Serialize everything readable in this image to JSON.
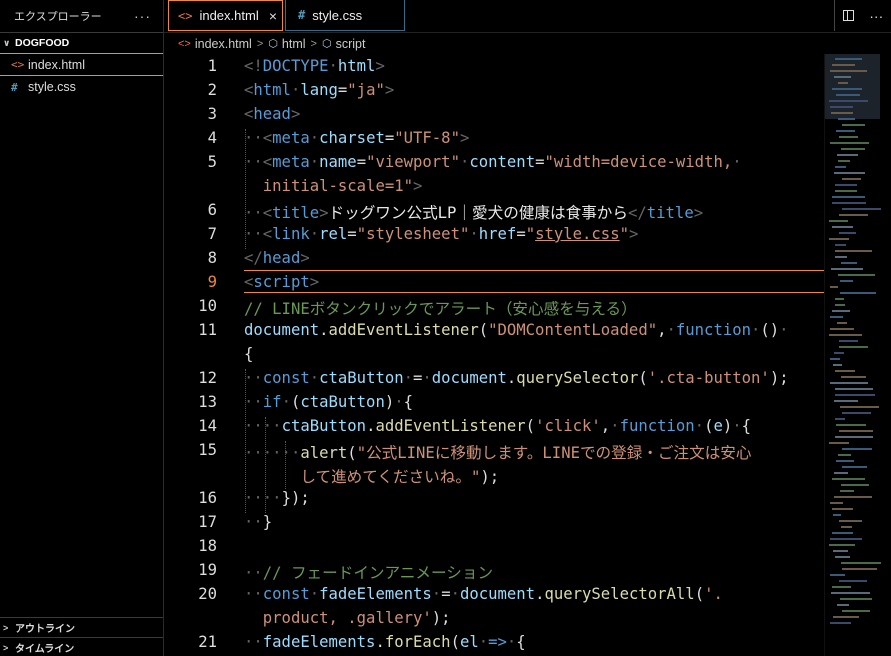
{
  "sidebar": {
    "title": "エクスプローラー",
    "more": "···",
    "folder": "DOGFOOD",
    "files": [
      {
        "name": "index.html",
        "icon": "<>"
      },
      {
        "name": "style.css",
        "icon": "#"
      }
    ],
    "outline": "アウトライン",
    "timeline": "タイムライン"
  },
  "tabs": [
    {
      "label": "index.html",
      "icon": "<>",
      "close": "×"
    },
    {
      "label": "style.css",
      "icon": "#"
    }
  ],
  "breadcrumb": [
    "index.html",
    "html",
    "script"
  ],
  "lines": [
    "1",
    "2",
    "3",
    "4",
    "5",
    "6",
    "7",
    "8",
    "9",
    "10",
    "11",
    "12",
    "13",
    "14",
    "15",
    "16",
    "17",
    "18",
    "19",
    "20",
    "21"
  ],
  "colors": {
    "accent": "#f0883e",
    "keyword": "#569cd6",
    "string": "#ce9178",
    "comment": "#6a9955",
    "function": "#dcdcaa"
  },
  "code": {
    "l1": {
      "open": "<!",
      "kw": "DOCTYPE",
      "rest": "html",
      "close": ">"
    },
    "l2": {
      "tag": "html",
      "attr": "lang",
      "val": "\"ja\""
    },
    "l3": {
      "tag": "head"
    },
    "l4": {
      "tag": "meta",
      "attr": "charset",
      "val": "\"UTF-8\""
    },
    "l5": {
      "tag": "meta",
      "attr1": "name",
      "val1": "\"viewport\"",
      "attr2": "content",
      "val2a": "\"width=device-width,",
      "val2b": "initial-scale=1\""
    },
    "l6": {
      "tag": "title",
      "text": "ドッグワン公式LP｜愛犬の健康は食事から"
    },
    "l7": {
      "tag": "link",
      "attr1": "rel",
      "val1": "\"stylesheet\"",
      "attr2": "href",
      "val2": "style.css"
    },
    "l8": {
      "tag": "head"
    },
    "l9": {
      "tag": "script"
    },
    "l10": {
      "comment": "// LINEボタンクリックでアラート（安心感を与える）"
    },
    "l11": {
      "obj": "document",
      "fn": "addEventListener",
      "str": "\"DOMContentLoaded\"",
      "kw": "function"
    },
    "l12": {
      "kw": "const",
      "v": "ctaButton",
      "obj": "document",
      "fn": "querySelector",
      "str": "'.cta-button'"
    },
    "l13": {
      "kw": "if",
      "v": "ctaButton"
    },
    "l14": {
      "v": "ctaButton",
      "fn": "addEventListener",
      "str": "'click'",
      "kw": "function",
      "p": "e"
    },
    "l15": {
      "fn": "alert",
      "str1": "\"公式LINEに移動します。LINEでの登録・ご注文は安心",
      "str2": "して進めてくださいね。\""
    },
    "l19": {
      "comment": "// フェードインアニメーション"
    },
    "l20": {
      "kw": "const",
      "v": "fadeElements",
      "obj": "document",
      "fn": "querySelectorAll",
      "str1": "'.",
      "str2": "product, .gallery'"
    },
    "l21": {
      "v": "fadeElements",
      "fn": "forEach",
      "p": "el"
    }
  }
}
